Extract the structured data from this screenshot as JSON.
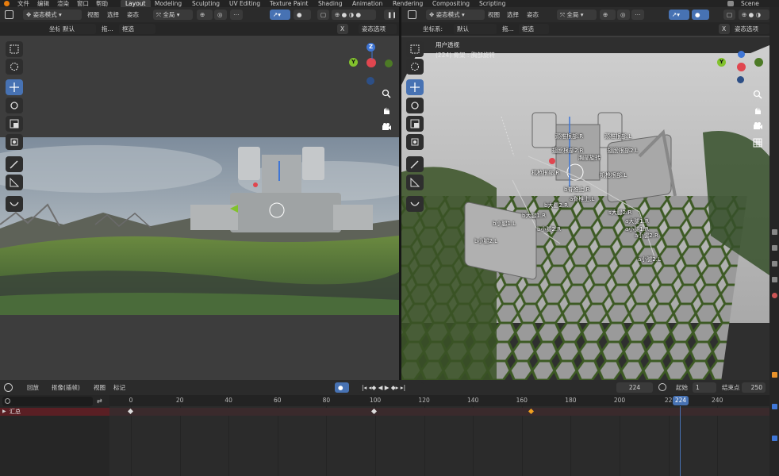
{
  "top_menu": [
    {
      "label": "文件"
    },
    {
      "label": "编辑"
    },
    {
      "label": "渲染"
    },
    {
      "label": "窗口"
    },
    {
      "label": "帮助"
    }
  ],
  "workspace_tabs": [
    {
      "label": "Layout",
      "active": true
    },
    {
      "label": "Modeling"
    },
    {
      "label": "Sculpting"
    },
    {
      "label": "UV Editing"
    },
    {
      "label": "Texture Paint"
    },
    {
      "label": "Shading"
    },
    {
      "label": "Animation"
    },
    {
      "label": "Rendering"
    },
    {
      "label": "Compositing"
    },
    {
      "label": "Scripting"
    }
  ],
  "scene_name": "Scene",
  "left_viewport": {
    "mode": "姿态模式",
    "menus": [
      "视图",
      "选择",
      "姿态"
    ],
    "transform_orientation": "全局",
    "coord_label": "坐标系:",
    "coord_value": "默认",
    "drag_label": "拖...",
    "select_mode": "框选",
    "x_mirror": "X",
    "pose_options": "姿态选项"
  },
  "right_viewport": {
    "mode": "姿态模式",
    "menus": [
      "视图",
      "选择",
      "姿态"
    ],
    "transform_orientation": "全局",
    "coord_label": "坐标系:",
    "coord_value": "默认",
    "drag_label": "拖...",
    "select_mode": "框选",
    "x_mirror": "X",
    "pose_options": "姿态选项",
    "overlay_line1": "用户透视",
    "overlay_line2": "(224) 骨架 : 胸部旋转",
    "bone_labels": [
      "颈椎根部.R",
      "颈椎根部.L",
      "翅膀根部2.R",
      "翅膀根部2.L",
      "胸部旋转",
      "机枪根部.R",
      "机枪根部.L",
      "b脊椎上.R",
      "a脊椎上.L",
      "b大腿2.R",
      "b大腿1.R",
      "s大腿2.R",
      "a大腿1.R",
      "b小腿1.L",
      "b小腿2.R",
      "a小腿1.R",
      "a小腿2.R",
      "b小腿2.L",
      "a小腿2.L"
    ]
  },
  "timeline": {
    "menus": [
      "回放",
      "抠像(插帧)",
      "视图",
      "标记"
    ],
    "current_frame": "224",
    "start_label": "起始",
    "start_value": "1",
    "end_label": "结束点",
    "end_value": "250",
    "ruler_ticks": [
      "0",
      "20",
      "40",
      "60",
      "80",
      "100",
      "120",
      "140",
      "160",
      "180",
      "200",
      "22",
      "240"
    ],
    "playhead_label": "224",
    "summary_label": "汇总"
  },
  "colors": {
    "accent_blue": "#4772b3",
    "axis_x": "#e0464f",
    "axis_y": "#82c22d",
    "axis_z": "#3f76d6",
    "summary_row": "#5a1f24",
    "keyframe_selected": "#f0a020"
  }
}
